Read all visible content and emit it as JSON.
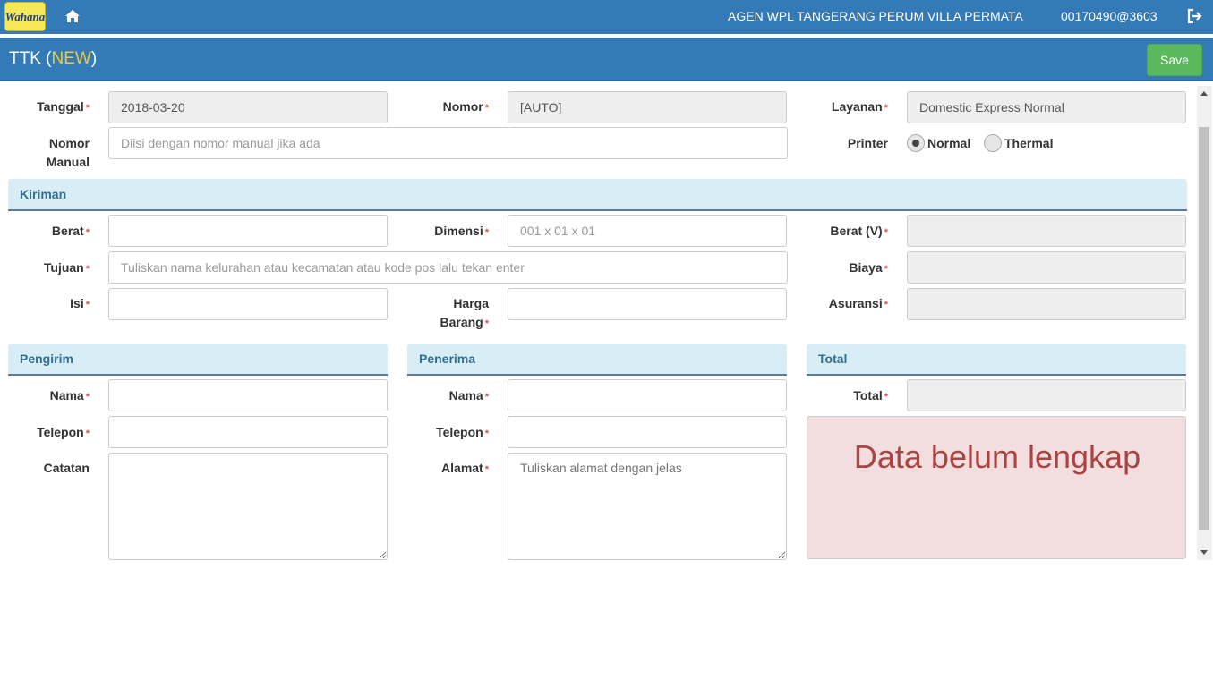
{
  "header": {
    "logo_text": "Wahana",
    "agent": "AGEN WPL TANGERANG PERUM VILLA PERMATA",
    "user": "00170490@3603",
    "color": "#337ab7"
  },
  "titlebar": {
    "title": "TTK",
    "status": "NEW",
    "save_label": "Save"
  },
  "form": {
    "tanggal": {
      "label": "Tanggal",
      "value": "2018-03-20"
    },
    "nomor": {
      "label": "Nomor",
      "value": "[AUTO]"
    },
    "layanan": {
      "label": "Layanan",
      "value": "Domestic Express Normal"
    },
    "nomor_manual": {
      "label_line1": "Nomor",
      "label_line2": "Manual",
      "placeholder": "Diisi dengan nomor manual jika ada"
    },
    "printer": {
      "label": "Printer",
      "options": [
        "Normal",
        "Thermal"
      ],
      "selected": "Normal"
    }
  },
  "kiriman": {
    "title": "Kiriman",
    "berat": {
      "label": "Berat",
      "value": ""
    },
    "dimensi": {
      "label": "Dimensi",
      "placeholder": "001 x 01 x 01"
    },
    "berat_v": {
      "label": "Berat (V)",
      "value": ""
    },
    "tujuan": {
      "label": "Tujuan",
      "placeholder": "Tuliskan nama kelurahan atau kecamatan atau kode pos lalu tekan enter"
    },
    "biaya": {
      "label": "Biaya",
      "value": ""
    },
    "isi": {
      "label": "Isi",
      "value": ""
    },
    "harga_barang": {
      "label_line1": "Harga",
      "label_line2": "Barang"
    },
    "asuransi": {
      "label": "Asuransi",
      "value": ""
    }
  },
  "pengirim": {
    "title": "Pengirim",
    "nama": {
      "label": "Nama"
    },
    "telepon": {
      "label": "Telepon"
    },
    "catatan": {
      "label": "Catatan"
    }
  },
  "penerima": {
    "title": "Penerima",
    "nama": {
      "label": "Nama"
    },
    "telepon": {
      "label": "Telepon"
    },
    "alamat": {
      "label": "Alamat",
      "placeholder": "Tuliskan alamat dengan jelas"
    }
  },
  "total": {
    "title": "Total",
    "label": "Total",
    "message": "Data belum lengkap"
  },
  "required_mark": "*"
}
